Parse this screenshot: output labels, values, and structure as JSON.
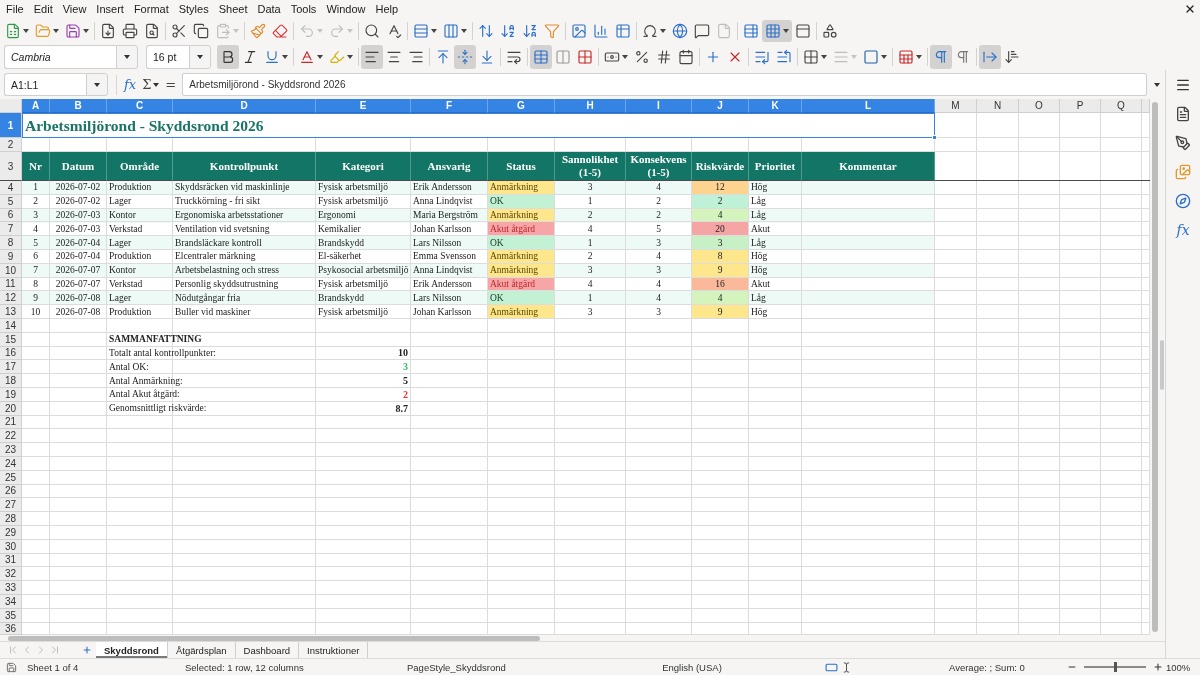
{
  "menu": [
    "File",
    "Edit",
    "View",
    "Insert",
    "Format",
    "Styles",
    "Sheet",
    "Data",
    "Tools",
    "Window",
    "Help"
  ],
  "standard_toolbar": [
    [
      {
        "kind": "new",
        "dropdown": true,
        "active": false,
        "disabled": false
      },
      {
        "kind": "open",
        "dropdown": true,
        "active": false,
        "disabled": false
      },
      {
        "kind": "save",
        "dropdown": true,
        "active": false,
        "disabled": false
      }
    ],
    [
      {
        "kind": "pdf",
        "dropdown": false,
        "active": false,
        "disabled": false
      },
      {
        "kind": "print",
        "dropdown": false,
        "active": false,
        "disabled": false
      },
      {
        "kind": "preview",
        "dropdown": false,
        "active": false,
        "disabled": false
      }
    ],
    [
      {
        "kind": "cut",
        "dropdown": false,
        "active": false,
        "disabled": false
      },
      {
        "kind": "copy",
        "dropdown": false,
        "active": false,
        "disabled": false
      },
      {
        "kind": "paste",
        "dropdown": true,
        "active": false,
        "disabled": true
      }
    ],
    [
      {
        "kind": "clone",
        "dropdown": false,
        "active": false,
        "disabled": false
      },
      {
        "kind": "clear",
        "dropdown": false,
        "active": false,
        "disabled": false
      }
    ],
    [
      {
        "kind": "undo",
        "dropdown": true,
        "active": false,
        "disabled": true
      },
      {
        "kind": "redo",
        "dropdown": true,
        "active": false,
        "disabled": true
      }
    ],
    [
      {
        "kind": "find",
        "dropdown": false,
        "active": false,
        "disabled": false
      },
      {
        "kind": "spelling",
        "dropdown": false,
        "active": false,
        "disabled": false
      }
    ],
    [
      {
        "kind": "rows",
        "dropdown": true,
        "active": false,
        "disabled": false
      },
      {
        "kind": "columns",
        "dropdown": true,
        "active": false,
        "disabled": false
      }
    ],
    [
      {
        "kind": "sort",
        "dropdown": false,
        "active": false,
        "disabled": false
      },
      {
        "kind": "ascending",
        "dropdown": false,
        "active": false,
        "disabled": false
      },
      {
        "kind": "descending",
        "dropdown": false,
        "active": false,
        "disabled": false
      },
      {
        "kind": "filter",
        "dropdown": false,
        "active": false,
        "disabled": false
      }
    ],
    [
      {
        "kind": "image",
        "dropdown": false,
        "active": false,
        "disabled": false
      },
      {
        "kind": "chart",
        "dropdown": false,
        "active": false,
        "disabled": false
      },
      {
        "kind": "pivot",
        "dropdown": false,
        "active": false,
        "disabled": false
      }
    ],
    [
      {
        "kind": "special",
        "dropdown": true,
        "active": false,
        "disabled": false
      },
      {
        "kind": "hyperlink",
        "dropdown": false,
        "active": false,
        "disabled": false
      },
      {
        "kind": "comment",
        "dropdown": false,
        "active": false,
        "disabled": false
      },
      {
        "kind": "headerfooter",
        "dropdown": false,
        "active": false,
        "disabled": true
      }
    ],
    [
      {
        "kind": "printrange",
        "dropdown": false,
        "active": false,
        "disabled": false
      },
      {
        "kind": "freeze",
        "dropdown": true,
        "active": true,
        "disabled": false
      },
      {
        "kind": "split",
        "dropdown": false,
        "active": false,
        "disabled": false
      }
    ],
    [
      {
        "kind": "shapes",
        "dropdown": false,
        "active": false,
        "disabled": false
      }
    ]
  ],
  "formatting_toolbar": {
    "font_name": "Cambria",
    "font_size": "16 pt",
    "groups": [
      [
        {
          "kind": "bold",
          "dropdown": false,
          "active": true,
          "disabled": false
        },
        {
          "kind": "italic",
          "dropdown": false,
          "active": false,
          "disabled": false
        },
        {
          "kind": "underline",
          "dropdown": true,
          "active": false,
          "disabled": false
        }
      ],
      [
        {
          "kind": "fontcolor",
          "dropdown": true,
          "active": false,
          "disabled": false
        },
        {
          "kind": "highlight",
          "dropdown": true,
          "active": false,
          "disabled": false
        }
      ],
      [
        {
          "kind": "left",
          "dropdown": false,
          "active": true,
          "disabled": false
        },
        {
          "kind": "center",
          "dropdown": false,
          "active": false,
          "disabled": false
        },
        {
          "kind": "right",
          "dropdown": false,
          "active": false,
          "disabled": false
        }
      ],
      [
        {
          "kind": "top",
          "dropdown": false,
          "active": false,
          "disabled": false
        },
        {
          "kind": "middle",
          "dropdown": false,
          "active": true,
          "disabled": false
        },
        {
          "kind": "bottom",
          "dropdown": false,
          "active": false,
          "disabled": false
        }
      ],
      [
        {
          "kind": "wrap",
          "dropdown": false,
          "active": false,
          "disabled": false
        }
      ],
      [
        {
          "kind": "mergecenter",
          "dropdown": false,
          "active": true,
          "disabled": false
        },
        {
          "kind": "merge",
          "dropdown": false,
          "active": false,
          "disabled": false
        },
        {
          "kind": "unmerge",
          "dropdown": false,
          "active": false,
          "disabled": false
        }
      ],
      [
        {
          "kind": "currency",
          "dropdown": true,
          "active": false,
          "disabled": false
        },
        {
          "kind": "percent",
          "dropdown": false,
          "active": false,
          "disabled": false
        },
        {
          "kind": "number",
          "dropdown": false,
          "active": false,
          "disabled": false
        },
        {
          "kind": "date",
          "dropdown": false,
          "active": false,
          "disabled": false
        }
      ],
      [
        {
          "kind": "adddecimal",
          "dropdown": false,
          "active": false,
          "disabled": false
        },
        {
          "kind": "deletedecimal",
          "dropdown": false,
          "active": false,
          "disabled": false
        }
      ],
      [
        {
          "kind": "indent",
          "dropdown": false,
          "active": false,
          "disabled": false
        },
        {
          "kind": "outdent",
          "dropdown": false,
          "active": false,
          "disabled": false
        }
      ],
      [
        {
          "kind": "borders",
          "dropdown": true,
          "active": false,
          "disabled": false
        },
        {
          "kind": "borderstyle",
          "dropdown": true,
          "active": false,
          "disabled": true
        },
        {
          "kind": "bordercolor",
          "dropdown": true,
          "active": false,
          "disabled": false
        }
      ],
      [
        {
          "kind": "conditional",
          "dropdown": true,
          "active": false,
          "disabled": false
        }
      ],
      [
        {
          "kind": "ltr",
          "dropdown": false,
          "active": true,
          "disabled": false
        },
        {
          "kind": "rtl",
          "dropdown": false,
          "active": false,
          "disabled": false
        }
      ],
      [
        {
          "kind": "direction",
          "dropdown": false,
          "active": true,
          "disabled": false
        },
        {
          "kind": "stacked",
          "dropdown": false,
          "active": false,
          "disabled": false
        }
      ]
    ]
  },
  "formula_bar": {
    "name_box": "A1:L1",
    "function_wizard": "fx",
    "sum": "Σ",
    "equals": "=",
    "content": "Arbetsmiljörond - Skyddsrond 2026"
  },
  "sidebar": {
    "functions": "fx"
  },
  "sheet": {
    "column_headers": [
      {
        "label": "A",
        "selected": true
      },
      {
        "label": "B",
        "selected": true
      },
      {
        "label": "C",
        "selected": true
      },
      {
        "label": "D",
        "selected": true
      },
      {
        "label": "E",
        "selected": true
      },
      {
        "label": "F",
        "selected": true
      },
      {
        "label": "G",
        "selected": true
      },
      {
        "label": "H",
        "selected": true
      },
      {
        "label": "I",
        "selected": true
      },
      {
        "label": "J",
        "selected": true
      },
      {
        "label": "K",
        "selected": true
      },
      {
        "label": "L",
        "selected": true
      },
      {
        "label": "M",
        "selected": false
      },
      {
        "label": "N",
        "selected": false
      },
      {
        "label": "O",
        "selected": false
      },
      {
        "label": "P",
        "selected": false
      },
      {
        "label": "Q",
        "selected": false
      }
    ],
    "row_headers": [
      {
        "label": "1",
        "selected": true
      },
      {
        "label": "2",
        "selected": false
      },
      {
        "label": "3",
        "selected": false
      },
      {
        "label": "4",
        "selected": false
      },
      {
        "label": "5",
        "selected": false
      },
      {
        "label": "6",
        "selected": false
      },
      {
        "label": "7",
        "selected": false
      },
      {
        "label": "8",
        "selected": false
      },
      {
        "label": "9",
        "selected": false
      },
      {
        "label": "10",
        "selected": false
      },
      {
        "label": "11",
        "selected": false
      },
      {
        "label": "12",
        "selected": false
      },
      {
        "label": "13",
        "selected": false
      },
      {
        "label": "14",
        "selected": false
      },
      {
        "label": "15",
        "selected": false
      },
      {
        "label": "16",
        "selected": false
      },
      {
        "label": "17",
        "selected": false
      },
      {
        "label": "18",
        "selected": false
      },
      {
        "label": "19",
        "selected": false
      },
      {
        "label": "20",
        "selected": false
      },
      {
        "label": "21",
        "selected": false
      },
      {
        "label": "22",
        "selected": false
      },
      {
        "label": "23",
        "selected": false
      },
      {
        "label": "24",
        "selected": false
      },
      {
        "label": "25",
        "selected": false
      },
      {
        "label": "26",
        "selected": false
      },
      {
        "label": "27",
        "selected": false
      },
      {
        "label": "28",
        "selected": false
      },
      {
        "label": "29",
        "selected": false
      },
      {
        "label": "30",
        "selected": false
      },
      {
        "label": "31",
        "selected": false
      },
      {
        "label": "32",
        "selected": false
      },
      {
        "label": "33",
        "selected": false
      },
      {
        "label": "34",
        "selected": false
      },
      {
        "label": "35",
        "selected": false
      },
      {
        "label": "36",
        "selected": false
      }
    ],
    "title": "Arbetsmiljörond - Skyddsrond 2026",
    "table": {
      "columns": [
        "Nr",
        "Datum",
        "Område",
        "Kontrollpunkt",
        "Kategori",
        "Ansvarig",
        "Status",
        "Sannolikhet (1-5)",
        "Konsekvens (1-5)",
        "Riskvärde",
        "Prioritet",
        "Kommentar"
      ],
      "rows": [
        {
          "nr": "1",
          "datum": "2026-07-02",
          "omrade": "Produktion",
          "kontrollpunkt": "Skyddsräcken vid maskinlinje",
          "kategori": "Fysisk arbetsmiljö",
          "ansvarig": "Erik Andersson",
          "status": {
            "text": "Anmärkning",
            "kind": "warning",
            "color": "#fde68c"
          },
          "sannolikhet": "3",
          "konsekvens": "4",
          "riskvarde": {
            "text": "12",
            "color": "#fdd48f"
          },
          "prioritet": "Hög"
        },
        {
          "nr": "2",
          "datum": "2026-07-02",
          "omrade": "Lager",
          "kontrollpunkt": "Truckkörning - fri sikt",
          "kategori": "Fysisk arbetsmiljö",
          "ansvarig": "Anna Lindqvist",
          "status": {
            "text": "OK",
            "kind": "ok",
            "color": "#c3f1d4"
          },
          "sannolikhet": "1",
          "konsekvens": "2",
          "riskvarde": {
            "text": "2",
            "color": "#bff1d6"
          },
          "prioritet": "Låg"
        },
        {
          "nr": "3",
          "datum": "2026-07-03",
          "omrade": "Kontor",
          "kontrollpunkt": "Ergonomiska arbetsstationer",
          "kategori": "Ergonomi",
          "ansvarig": "Maria Bergström",
          "status": {
            "text": "Anmärkning",
            "kind": "warning",
            "color": "#fde68c"
          },
          "sannolikhet": "2",
          "konsekvens": "2",
          "riskvarde": {
            "text": "4",
            "color": "#d4f3bd"
          },
          "prioritet": "Låg"
        },
        {
          "nr": "4",
          "datum": "2026-07-03",
          "omrade": "Verkstad",
          "kontrollpunkt": "Ventilation vid svetsning",
          "kategori": "Kemikalier",
          "ansvarig": "Johan Karlsson",
          "status": {
            "text": "Akut åtgärd",
            "kind": "critical",
            "color": "#f6a6a6"
          },
          "sannolikhet": "4",
          "konsekvens": "5",
          "riskvarde": {
            "text": "20",
            "color": "#f6a5a5"
          },
          "prioritet": "Akut"
        },
        {
          "nr": "5",
          "datum": "2026-07-04",
          "omrade": "Lager",
          "kontrollpunkt": "Brandsläckare kontroll",
          "kategori": "Brandskydd",
          "ansvarig": "Lars Nilsson",
          "status": {
            "text": "OK",
            "kind": "ok",
            "color": "#c3f1d4"
          },
          "sannolikhet": "1",
          "konsekvens": "3",
          "riskvarde": {
            "text": "3",
            "color": "#c8f0c6"
          },
          "prioritet": "Låg"
        },
        {
          "nr": "6",
          "datum": "2026-07-04",
          "omrade": "Produktion",
          "kontrollpunkt": "Elcentraler märkning",
          "kategori": "El-säkerhet",
          "ansvarig": "Emma Svensson",
          "status": {
            "text": "Anmärkning",
            "kind": "warning",
            "color": "#fde68c"
          },
          "sannolikhet": "2",
          "konsekvens": "4",
          "riskvarde": {
            "text": "8",
            "color": "#fde68c"
          },
          "prioritet": "Hög"
        },
        {
          "nr": "7",
          "datum": "2026-07-07",
          "omrade": "Kontor",
          "kontrollpunkt": "Arbetsbelastning och stress",
          "kategori": "Psykosocial arbetsmiljö",
          "ansvarig": "Anna Lindqvist",
          "status": {
            "text": "Anmärkning",
            "kind": "warning",
            "color": "#fde68c"
          },
          "sannolikhet": "3",
          "konsekvens": "3",
          "riskvarde": {
            "text": "9",
            "color": "#fde68c"
          },
          "prioritet": "Hög"
        },
        {
          "nr": "8",
          "datum": "2026-07-07",
          "omrade": "Verkstad",
          "kontrollpunkt": "Personlig skyddsutrustning",
          "kategori": "Fysisk arbetsmiljö",
          "ansvarig": "Erik Andersson",
          "status": {
            "text": "Akut åtgärd",
            "kind": "critical",
            "color": "#f6a6a6"
          },
          "sannolikhet": "4",
          "konsekvens": "4",
          "riskvarde": {
            "text": "16",
            "color": "#f9b99a"
          },
          "prioritet": "Akut"
        },
        {
          "nr": "9",
          "datum": "2026-07-08",
          "omrade": "Lager",
          "kontrollpunkt": "Nödutgångar fria",
          "kategori": "Brandskydd",
          "ansvarig": "Lars Nilsson",
          "status": {
            "text": "OK",
            "kind": "ok",
            "color": "#c3f1d4"
          },
          "sannolikhet": "1",
          "konsekvens": "4",
          "riskvarde": {
            "text": "4",
            "color": "#d4f3bd"
          },
          "prioritet": "Låg"
        },
        {
          "nr": "10",
          "datum": "2026-07-08",
          "omrade": "Produktion",
          "kontrollpunkt": "Buller vid maskiner",
          "kategori": "Fysisk arbetsmiljö",
          "ansvarig": "Johan Karlsson",
          "status": {
            "text": "Anmärkning",
            "kind": "warning",
            "color": "#fde68c"
          },
          "sannolikhet": "3",
          "konsekvens": "3",
          "riskvarde": {
            "text": "9",
            "color": "#fde68c"
          },
          "prioritet": "Hög"
        }
      ]
    },
    "summary": {
      "heading": "SAMMANFATTNING",
      "items": [
        {
          "label": "Totalt antal kontrollpunkter:",
          "value": "10",
          "color": "#222222"
        },
        {
          "label": "Antal OK:",
          "value": "3",
          "color": "#2fbf5f"
        },
        {
          "label": "Antal Anmärkning:",
          "value": "5",
          "color": "#222222"
        },
        {
          "label": "Antal Akut åtgärd:",
          "value": "2",
          "color": "#e53935"
        },
        {
          "label": "Genomsnittligt riskvärde:",
          "value": "8.7",
          "color": "#222222"
        }
      ]
    }
  },
  "sheet_tabs": [
    {
      "label": "Skyddsrond",
      "selected": true
    },
    {
      "label": "Åtgärdsplan",
      "selected": false
    },
    {
      "label": "Dashboard",
      "selected": false
    },
    {
      "label": "Instruktioner",
      "selected": false
    }
  ],
  "status_bar": {
    "sheet": "Sheet 1 of 4",
    "selection": "Selected: 1 row, 12 columns",
    "page_style": "PageStyle_Skyddsrond",
    "language": "English (USA)",
    "statistics": "Average: ; Sum: 0",
    "zoom_slider": {
      "level": 0.5
    },
    "zoom": "100%"
  }
}
